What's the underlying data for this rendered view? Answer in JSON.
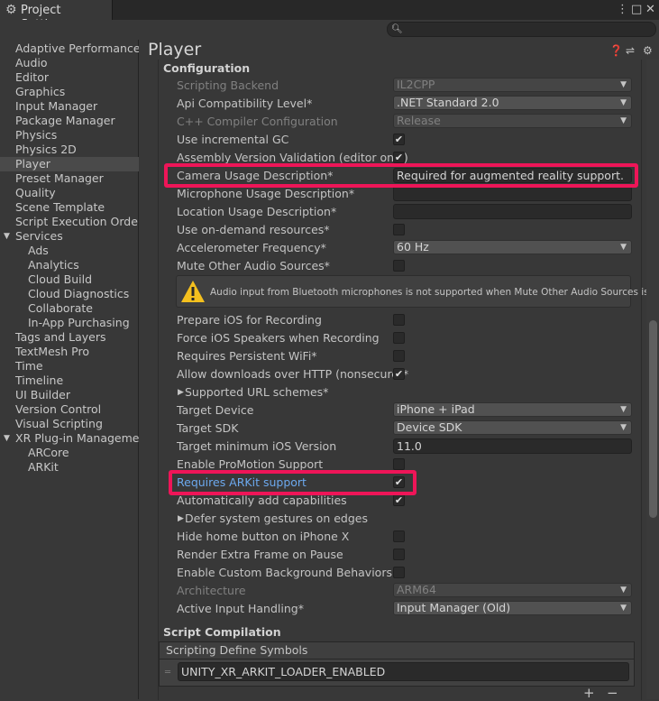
{
  "window": {
    "tab_title": "Project Settings",
    "tab_icon": "gear-icon",
    "menu_icon": "⋮",
    "maximize_icon": "□",
    "close_icon": "✕",
    "search_placeholder": ""
  },
  "sidebar": {
    "items": [
      {
        "label": "Adaptive Performance"
      },
      {
        "label": "Audio"
      },
      {
        "label": "Editor"
      },
      {
        "label": "Graphics"
      },
      {
        "label": "Input Manager"
      },
      {
        "label": "Package Manager"
      },
      {
        "label": "Physics"
      },
      {
        "label": "Physics 2D"
      },
      {
        "label": "Player",
        "selected": true
      },
      {
        "label": "Preset Manager"
      },
      {
        "label": "Quality"
      },
      {
        "label": "Scene Template"
      },
      {
        "label": "Script Execution Order"
      },
      {
        "label": "Services",
        "expanded": true
      },
      {
        "label": "Ads"
      },
      {
        "label": "Analytics"
      },
      {
        "label": "Cloud Build"
      },
      {
        "label": "Cloud Diagnostics"
      },
      {
        "label": "Collaborate"
      },
      {
        "label": "In-App Purchasing"
      },
      {
        "label": "Tags and Layers"
      },
      {
        "label": "TextMesh Pro"
      },
      {
        "label": "Time"
      },
      {
        "label": "Timeline"
      },
      {
        "label": "UI Builder"
      },
      {
        "label": "Version Control"
      },
      {
        "label": "Visual Scripting"
      },
      {
        "label": "XR Plug-in Management",
        "expanded": true
      },
      {
        "label": "ARCore"
      },
      {
        "label": "ARKit"
      }
    ]
  },
  "player": {
    "title": "Player",
    "configuration_header": "Configuration",
    "scripting_backend": {
      "label": "Scripting Backend",
      "value": "IL2CPP"
    },
    "api_compat": {
      "label": "Api Compatibility Level*",
      "value": ".NET Standard 2.0"
    },
    "cpp_compiler": {
      "label": "C++ Compiler Configuration",
      "value": "Release"
    },
    "incremental_gc": {
      "label": "Use incremental GC",
      "checked": true
    },
    "assembly_validation": {
      "label": "Assembly Version Validation (editor only)",
      "checked": true
    },
    "camera_usage": {
      "label": "Camera Usage Description*",
      "value": "Required for augmented reality support."
    },
    "microphone_usage": {
      "label": "Microphone Usage Description*",
      "value": ""
    },
    "location_usage": {
      "label": "Location Usage Description*",
      "value": ""
    },
    "on_demand": {
      "label": "Use on-demand resources*",
      "checked": false
    },
    "accel_freq": {
      "label": "Accelerometer Frequency*",
      "value": "60 Hz"
    },
    "mute_audio": {
      "label": "Mute Other Audio Sources*",
      "checked": false
    },
    "warning": "Audio input from Bluetooth microphones is not supported when Mute Other Audio Sources is off.",
    "prepare_ios": {
      "label": "Prepare iOS for Recording",
      "checked": false
    },
    "force_speakers": {
      "label": "Force iOS Speakers when Recording",
      "checked": false
    },
    "persistent_wifi": {
      "label": "Requires Persistent WiFi*",
      "checked": false
    },
    "allow_http": {
      "label": "Allow downloads over HTTP (nonsecure)*",
      "checked": true
    },
    "url_schemes": {
      "label": "Supported URL schemes*"
    },
    "target_device": {
      "label": "Target Device",
      "value": "iPhone + iPad"
    },
    "target_sdk": {
      "label": "Target SDK",
      "value": "Device SDK"
    },
    "min_ios": {
      "label": "Target minimum iOS Version",
      "value": "11.0"
    },
    "promotion": {
      "label": "Enable ProMotion Support",
      "checked": false
    },
    "arkit": {
      "label": "Requires ARKit support",
      "checked": true
    },
    "auto_caps": {
      "label": "Automatically add capabilities",
      "checked": true
    },
    "defer_gestures": {
      "label": "Defer system gestures on edges"
    },
    "hide_home": {
      "label": "Hide home button on iPhone X",
      "checked": false
    },
    "extra_frame": {
      "label": "Render Extra Frame on Pause",
      "checked": false
    },
    "custom_bg": {
      "label": "Enable Custom Background Behaviors",
      "checked": false
    },
    "architecture": {
      "label": "Architecture",
      "value": "ARM64"
    },
    "input_handling": {
      "label": "Active Input Handling*",
      "value": "Input Manager (Old)"
    },
    "script_compilation_header": "Script Compilation",
    "define_symbols": {
      "label": "Scripting Define Symbols",
      "items": [
        "UNITY_XR_ARKIT_LOADER_ENABLED"
      ]
    },
    "add_icon": "+",
    "remove_icon": "−"
  },
  "colors": {
    "highlight_box": "#ee1558",
    "selected_label": "#6ca9ee",
    "background": "#383838"
  }
}
